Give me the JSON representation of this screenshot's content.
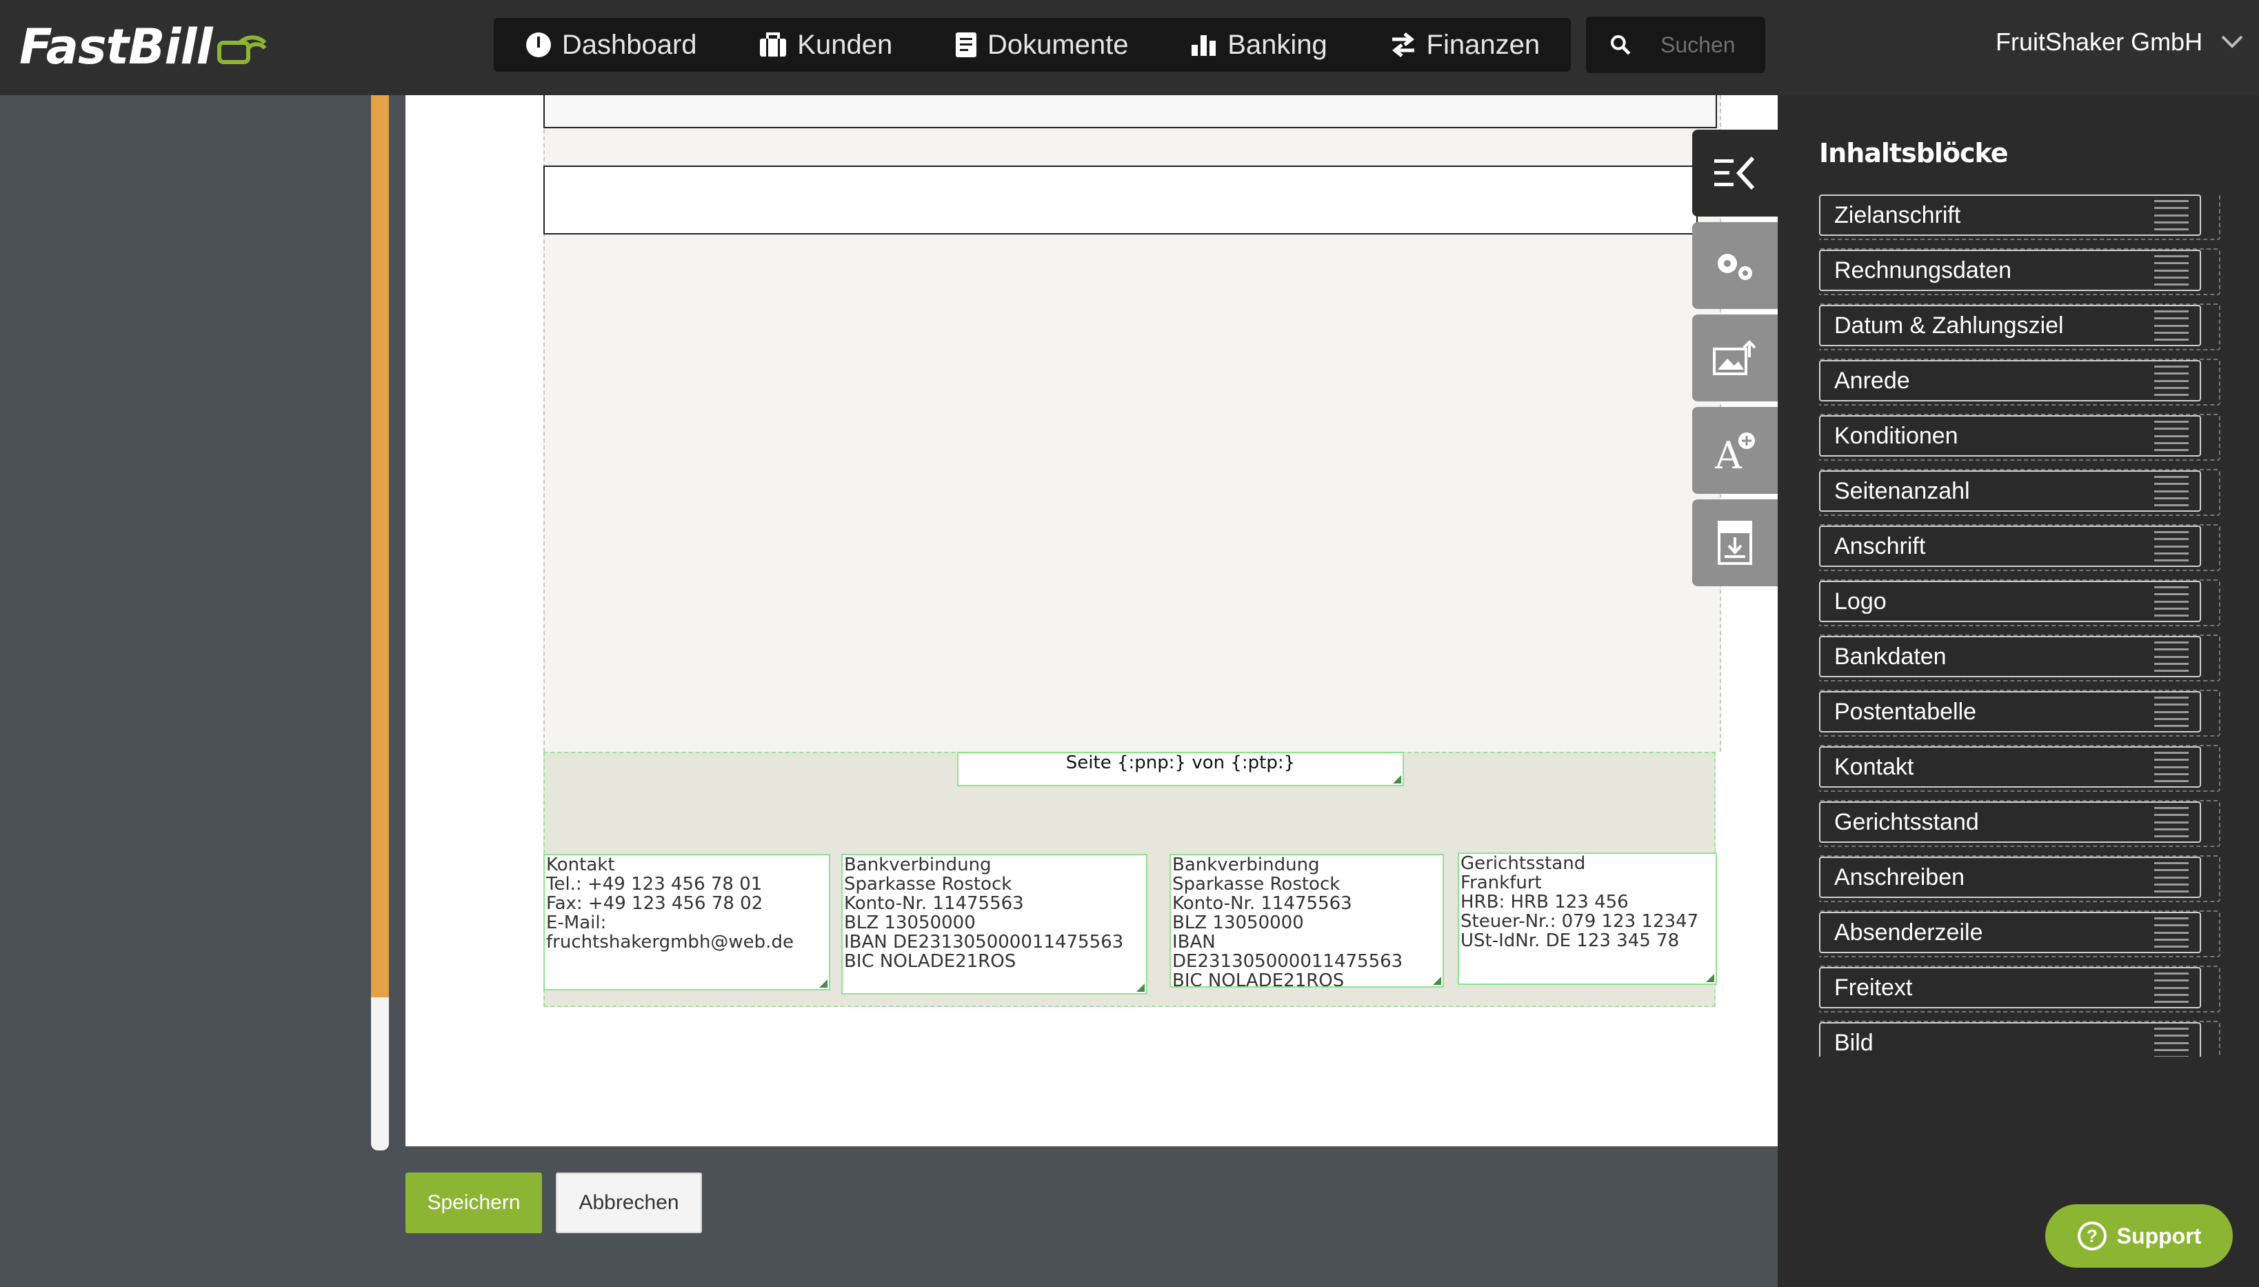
{
  "app": {
    "logo_text": "FastBill"
  },
  "nav": {
    "dashboard": "Dashboard",
    "kunden": "Kunden",
    "dokumente": "Dokumente",
    "banking": "Banking",
    "finanzen": "Finanzen"
  },
  "search": {
    "placeholder": "Suchen"
  },
  "account": {
    "company": "FruitShaker GmbH"
  },
  "document": {
    "page_number": "Seite {:pnp:} von {:ptp:}",
    "footer": [
      "Kontakt\nTel.: +49 123 456 78 01\nFax: +49 123 456 78 02\nE-Mail:\nfruchtshakergmbh@web.de",
      "Bankverbindung\nSparkasse Rostock\nKonto-Nr. 11475563\nBLZ 13050000\nIBAN DE231305000011475563\nBIC NOLADE21ROS",
      "Bankverbindung\nSparkasse Rostock\nKonto-Nr. 11475563\nBLZ 13050000\nIBAN\nDE231305000011475563\nBIC NOLADE21ROS",
      "Gerichtsstand\nFrankfurt\nHRB: HRB 123 456\nSteuer-Nr.: 079 123 12347\nUSt-IdNr. DE 123 345 78"
    ]
  },
  "actions": {
    "save": "Speichern",
    "cancel": "Abbrechen"
  },
  "panel": {
    "title": "Inhaltsblöcke",
    "tabs": [
      "content-blocks-icon",
      "settings-gears-icon",
      "image-upload-icon",
      "add-font-icon",
      "pdf-download-icon"
    ],
    "blocks": [
      "Zielanschrift",
      "Rechnungsdaten",
      "Datum & Zahlungsziel",
      "Anrede",
      "Konditionen",
      "Seitenanzahl",
      "Anschrift",
      "Logo",
      "Bankdaten",
      "Postentabelle",
      "Kontakt",
      "Gerichtsstand",
      "Anschreiben",
      "Absenderzeile",
      "Freitext",
      "Bild"
    ]
  },
  "support": {
    "label": "Support"
  },
  "colors": {
    "accent": "#8db534",
    "topbar": "#2f2f2f",
    "panel": "#2b2b2b",
    "scrollbar": "#e4a146"
  }
}
